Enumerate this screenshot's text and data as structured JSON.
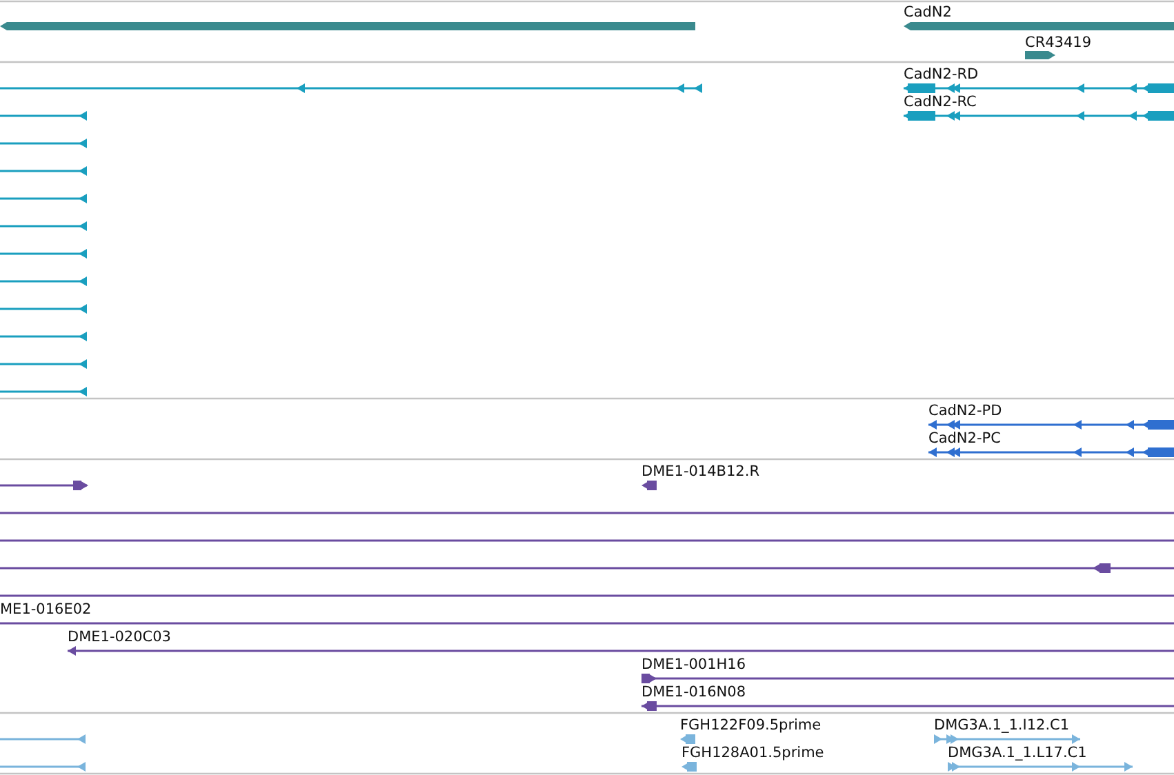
{
  "tracks": [
    {
      "kind": "gene",
      "color": "#3a8a8e",
      "features": [
        {
          "reverse": true
        },
        {
          "label": "CadN2",
          "reverse": true
        },
        {
          "label": "CR43419",
          "reverse": false
        }
      ]
    },
    {
      "kind": "transcript",
      "color": "#1a9fbf",
      "features": [
        {
          "reverse": true
        },
        {
          "label": "CadN2-RD",
          "reverse": true
        },
        {
          "reverse": true
        },
        {
          "label": "CadN2-RC",
          "reverse": true
        },
        {
          "reverse": true
        },
        {
          "reverse": true
        },
        {
          "reverse": true
        },
        {
          "reverse": true
        },
        {
          "reverse": true
        },
        {
          "reverse": true
        },
        {
          "reverse": true
        },
        {
          "reverse": true
        },
        {
          "reverse": true
        },
        {
          "reverse": true
        }
      ]
    },
    {
      "kind": "protein",
      "color": "#2f6fd0",
      "features": [
        {
          "label": "CadN2-PD",
          "reverse": true
        },
        {
          "label": "CadN2-PC",
          "reverse": true
        }
      ]
    },
    {
      "kind": "alignment",
      "color": "#6a4ca0",
      "features": [
        {
          "kind": "match",
          "reverse": false
        },
        {
          "kind": "match",
          "label": "DME1-014B12.R",
          "reverse": true
        },
        {
          "kind": "span"
        },
        {
          "kind": "span"
        },
        {
          "kind": "match",
          "reverse": true
        },
        {
          "kind": "span"
        },
        {
          "kind": "span",
          "label": "ME1-016E02"
        },
        {
          "kind": "match",
          "label": "DME1-020C03",
          "reverse": true
        },
        {
          "kind": "match",
          "label": "DME1-001H16",
          "reverse": false
        },
        {
          "kind": "match",
          "label": "DME1-016N08",
          "reverse": true
        }
      ]
    },
    {
      "kind": "est",
      "color": "#7ab4dc",
      "features": [
        {
          "reverse": true
        },
        {
          "label": "FGH122F09.5prime",
          "reverse": true
        },
        {
          "label": "DMG3A.1_1.I12.C1",
          "reverse": false
        },
        {
          "reverse": true
        },
        {
          "label": "FGH128A01.5prime",
          "reverse": true
        },
        {
          "label": "DMG3A.1_1.L17.C1",
          "reverse": false
        }
      ]
    }
  ]
}
